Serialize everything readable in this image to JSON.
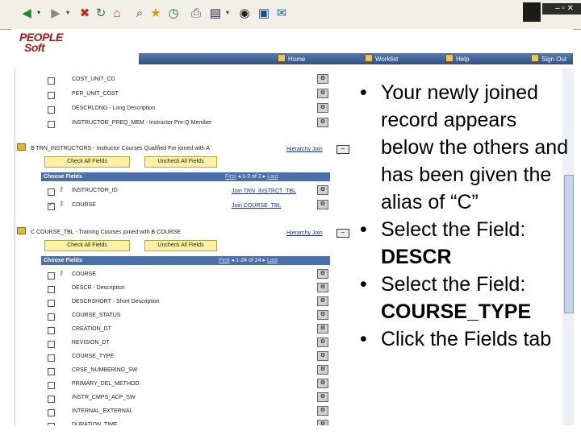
{
  "browser": {
    "toolbar_icons": [
      "back-icon",
      "forward-icon",
      "stop-icon",
      "refresh-icon",
      "home-icon",
      "search-icon",
      "favorites-icon",
      "history-icon",
      "mail-icon",
      "print-icon",
      "edit-icon",
      "discuss-icon",
      "messenger-icon"
    ],
    "window_controls": "– ▫ ✕"
  },
  "header": {
    "logo_line1": "PEOPLE",
    "logo_line2": "Soft",
    "nav": [
      {
        "label": "Home"
      },
      {
        "label": "Worklist"
      },
      {
        "label": "Help"
      },
      {
        "label": "Sign Out"
      }
    ]
  },
  "panel": {
    "top_fields": [
      {
        "name": "COST_UNIT_CD"
      },
      {
        "name": "PER_UNIT_COST"
      },
      {
        "name": "DESCRLONG - Long Description"
      },
      {
        "name": "INSTRUCTOR_PREQ_MEM - Instructor Pre-Q Member"
      }
    ],
    "record_b": {
      "label": "B   TRN_INSTRUCTORS - Instructor Courses Qualified For joined with A",
      "hierarchy": "Hierarchy Join",
      "check_all": "Check All Fields",
      "uncheck_all": "Uncheck All Fields",
      "grid_title": "Choose Fields",
      "grid_nav_first": "First",
      "grid_nav_range": "1-2 of 2",
      "grid_nav_last": "Last",
      "fields": [
        {
          "name": "INSTRUCTOR_ID",
          "join": "Join TRN_INSTRCT_TBL",
          "checked": false
        },
        {
          "name": "COURSE",
          "join": "Join COURSE_TBL",
          "checked": true
        }
      ]
    },
    "record_c": {
      "label": "C   COURSE_TBL - Training Courses joined with B COURSE",
      "hierarchy": "Hierarchy Join",
      "check_all": "Check All Fields",
      "uncheck_all": "Uncheck All Fields",
      "grid_title": "Choose Fields",
      "grid_nav_first": "First",
      "grid_nav_range": "1-24 of 24",
      "grid_nav_last": "Last",
      "fields": [
        {
          "name": "COURSE"
        },
        {
          "name": "DESCR - Description"
        },
        {
          "name": "DESCRSHORT - Short Description"
        },
        {
          "name": "COURSE_STATUS"
        },
        {
          "name": "CREATION_DT"
        },
        {
          "name": "REVISION_DT"
        },
        {
          "name": "COURSE_TYPE"
        },
        {
          "name": "CRSE_NUMBERING_SW"
        },
        {
          "name": "PRIMARY_DEL_METHOD"
        },
        {
          "name": "INSTR_CMPS_ACP_SW"
        },
        {
          "name": "INTERNAL_EXTERNAL"
        },
        {
          "name": "DURATION_TIME"
        }
      ]
    }
  },
  "bullets": [
    {
      "text": "Your newly joined record appears below the others and has been given the alias of “C”"
    },
    {
      "prefix": "Select the Field: ",
      "bold": "DESCR"
    },
    {
      "prefix": "Select the Field: ",
      "bold": "COURSE_TYPE"
    },
    {
      "text": "Click the Fields tab"
    }
  ]
}
